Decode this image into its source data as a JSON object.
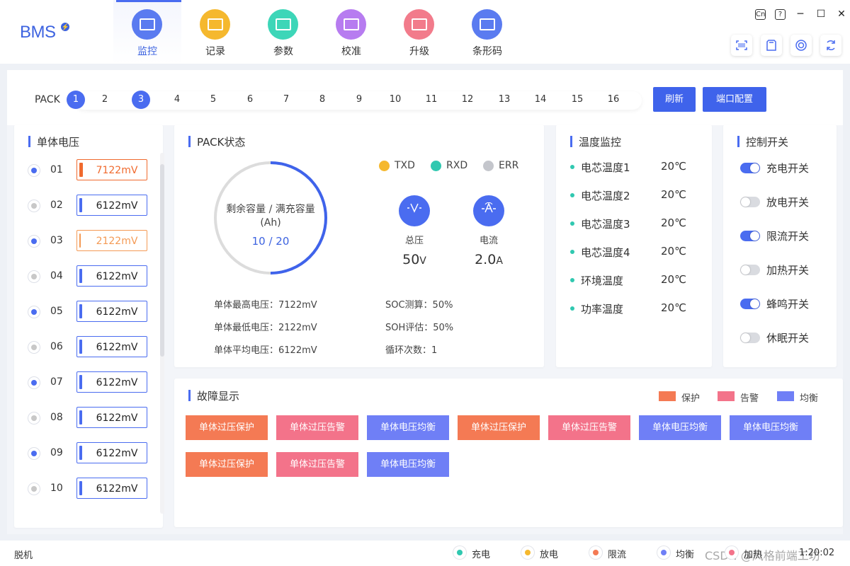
{
  "app": {
    "logo": "BMS",
    "logo_badge": "⚡"
  },
  "nav": [
    {
      "label": "监控",
      "icon": "monitor-icon",
      "color": "#5a7bf0",
      "active": true
    },
    {
      "label": "记录",
      "icon": "record-icon",
      "color": "#f5b82e"
    },
    {
      "label": "参数",
      "icon": "params-icon",
      "color": "#3dd6b8"
    },
    {
      "label": "校准",
      "icon": "calibrate-icon",
      "color": "#b77cf0"
    },
    {
      "label": "升级",
      "icon": "upgrade-icon",
      "color": "#f27b8b"
    },
    {
      "label": "条形码",
      "icon": "barcode-icon",
      "color": "#5a7bf0"
    }
  ],
  "window_controls": {
    "lang": "Cn",
    "help": "?",
    "minimize": "─",
    "maximize": "☐",
    "close": "✕"
  },
  "toolbar": [
    "scan-icon",
    "sd-card-icon",
    "target-icon",
    "refresh-icon"
  ],
  "pack": {
    "label": "PACK",
    "numbers": [
      "1",
      "2",
      "3",
      "4",
      "5",
      "6",
      "7",
      "8",
      "9",
      "10",
      "11",
      "12",
      "13",
      "14",
      "15",
      "16"
    ],
    "selected": [
      "1",
      "3"
    ],
    "refresh_label": "刷新",
    "port_config_label": "端口配置"
  },
  "cells": {
    "title": "单体电压",
    "items": [
      {
        "idx": "01",
        "value": "7122mV",
        "level": "high",
        "on": true
      },
      {
        "idx": "02",
        "value": "6122mV",
        "level": "normal",
        "on": false
      },
      {
        "idx": "03",
        "value": "2122mV",
        "level": "low",
        "on": true
      },
      {
        "idx": "04",
        "value": "6122mV",
        "level": "normal",
        "on": false
      },
      {
        "idx": "05",
        "value": "6122mV",
        "level": "normal",
        "on": true
      },
      {
        "idx": "06",
        "value": "6122mV",
        "level": "normal",
        "on": false
      },
      {
        "idx": "07",
        "value": "6122mV",
        "level": "normal",
        "on": true
      },
      {
        "idx": "08",
        "value": "6122mV",
        "level": "normal",
        "on": false
      },
      {
        "idx": "09",
        "value": "6122mV",
        "level": "normal",
        "on": true
      },
      {
        "idx": "10",
        "value": "6122mV",
        "level": "normal",
        "on": false
      }
    ]
  },
  "pack_status": {
    "title": "PACK状态",
    "capacity_label": "剩余容量 / 满充容量",
    "capacity_unit": "(Ah)",
    "capacity_value": "10 / 20",
    "capacity_fraction": 0.5,
    "leds": [
      {
        "label": "TXD",
        "color": "#f5b82e"
      },
      {
        "label": "RXD",
        "color": "#30c8b0"
      },
      {
        "label": "ERR",
        "color": "#c4c6cc"
      }
    ],
    "voltage": {
      "label": "总压",
      "value": "50",
      "unit": "V",
      "icon": "voltage-icon"
    },
    "current": {
      "label": "电流",
      "value": "2.0",
      "unit": "A",
      "icon": "current-icon"
    },
    "stats_left": [
      "单体最高电压：7122mV",
      "单体最低电压：2122mV",
      "单体平均电压：6122mV"
    ],
    "stats_right": [
      "SOC测算：50%",
      "SOH评估：50%",
      "循环次数：1"
    ]
  },
  "temperature": {
    "title": "温度监控",
    "items": [
      {
        "name": "电芯温度1",
        "value": "20℃"
      },
      {
        "name": "电芯温度2",
        "value": "20℃"
      },
      {
        "name": "电芯温度3",
        "value": "20℃"
      },
      {
        "name": "电芯温度4",
        "value": "20℃"
      },
      {
        "name": "环境温度",
        "value": "20℃"
      },
      {
        "name": "功率温度",
        "value": "20℃"
      }
    ]
  },
  "switches": {
    "title": "控制开关",
    "items": [
      {
        "label": "充电开关",
        "on": true
      },
      {
        "label": "放电开关",
        "on": false
      },
      {
        "label": "限流开关",
        "on": true
      },
      {
        "label": "加热开关",
        "on": false
      },
      {
        "label": "蜂鸣开关",
        "on": true
      },
      {
        "label": "休眠开关",
        "on": false
      }
    ]
  },
  "faults": {
    "title": "故障显示",
    "legend": [
      {
        "label": "保护",
        "color": "#f47a54"
      },
      {
        "label": "告警",
        "color": "#f3738a"
      },
      {
        "label": "均衡",
        "color": "#6f7ff6"
      }
    ],
    "items": [
      {
        "label": "单体过压保护",
        "type": "protect"
      },
      {
        "label": "单体过压告警",
        "type": "alarm"
      },
      {
        "label": "单体电压均衡",
        "type": "balance"
      },
      {
        "label": "单体过压保护",
        "type": "protect"
      },
      {
        "label": "单体过压告警",
        "type": "alarm"
      },
      {
        "label": "单体电压均衡",
        "type": "balance"
      },
      {
        "label": "单体电压均衡",
        "type": "balance"
      },
      {
        "label": "单体过压保护",
        "type": "protect"
      },
      {
        "label": "单体过压告警",
        "type": "alarm"
      },
      {
        "label": "单体电压均衡",
        "type": "balance"
      }
    ]
  },
  "statusbar": {
    "connection": "脱机",
    "indicators": [
      {
        "label": "充电",
        "color": "#30c8b0"
      },
      {
        "label": "放电",
        "color": "#f5b82e"
      },
      {
        "label": "限流",
        "color": "#f47a54"
      },
      {
        "label": "均衡",
        "color": "#6f7ff6"
      },
      {
        "label": "加热",
        "color": "#f3738a"
      }
    ],
    "time": "1:20:02",
    "watermark": "CSDN @风格前端工坊"
  }
}
